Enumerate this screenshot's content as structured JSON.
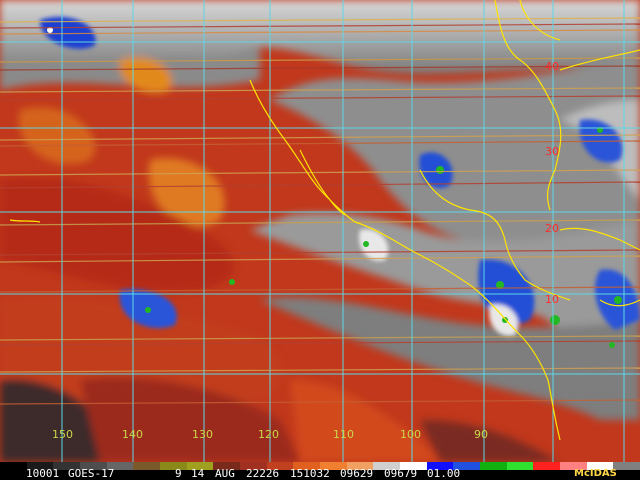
{
  "product": {
    "id_code": "10001",
    "satellite": "GOES-17",
    "band": "9",
    "day": "14",
    "month": "AUG",
    "julian": "22226",
    "time": "151032",
    "value_a": "09629",
    "value_b": "09679",
    "res": "01.00",
    "software": "McIDAS"
  },
  "grid": {
    "lat_labels": [
      "40",
      "30",
      "20",
      "10"
    ],
    "lon_labels": [
      "150",
      "140",
      "130",
      "120",
      "110",
      "100",
      "90"
    ]
  },
  "colors": {
    "grid_line": "#5fd6e6",
    "coast_line": "#ffe400",
    "lat_label": "#ff2b2b",
    "lon_label": "#c7d84a"
  }
}
